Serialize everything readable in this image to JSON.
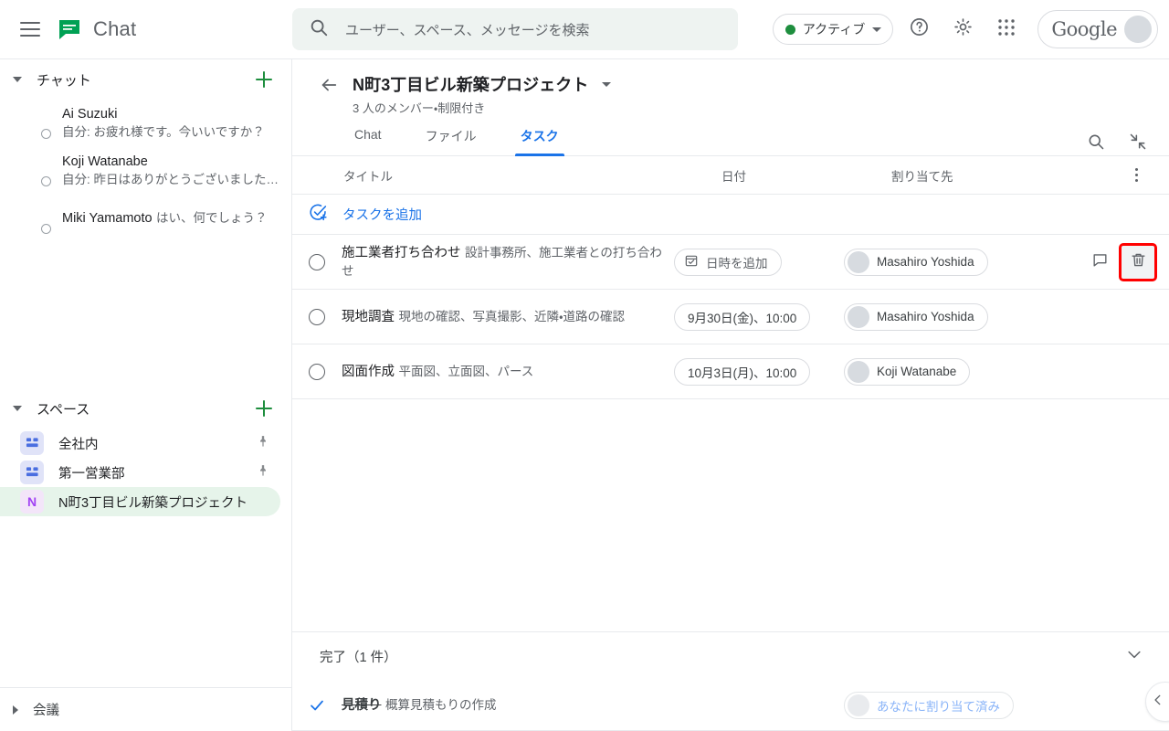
{
  "app": {
    "brand_name": "Chat",
    "logo_color": "#00a154"
  },
  "topbar": {
    "menu_icon": "hamburger-icon",
    "search_placeholder": "ユーザー、スペース、メッセージを検索",
    "search_icon": "search-icon",
    "status_label": "アクティブ",
    "status_color": "#1e8e3e",
    "help_icon": "help-icon",
    "settings_icon": "gear-icon",
    "apps_icon": "apps-grid-icon",
    "account_word": "Google",
    "avatar_icon": "account-avatar"
  },
  "sidebar": {
    "chat_section": {
      "title": "チャット",
      "add_icon": "plus-icon",
      "items": [
        {
          "name": "Ai Suzuki",
          "snippet": "自分: お疲れ様です。今いいですか？"
        },
        {
          "name": "Koji Watanabe",
          "snippet": "自分: 昨日はありがとうございました…"
        },
        {
          "name": "Miki Yamamoto",
          "snippet": "はい、何でしょう？"
        }
      ]
    },
    "spaces_section": {
      "title": "スペース",
      "add_icon": "plus-icon",
      "items": [
        {
          "label": "全社内",
          "icon": "space-grid-icon",
          "pinned": true,
          "active": false
        },
        {
          "label": "第一営業部",
          "icon": "space-grid-icon",
          "pinned": true,
          "active": false
        },
        {
          "label": "N町3丁目ビル新築プロジェクト",
          "icon": "N",
          "pinned": false,
          "active": true
        }
      ]
    },
    "meetings_section": {
      "title": "会議"
    }
  },
  "main": {
    "back_icon": "back-arrow-icon",
    "space_title": "N町3丁目ビル新築プロジェクト",
    "space_dropdown_icon": "chevron-down-icon",
    "space_subtitle": "3 人のメンバー・制限付き",
    "search_icon": "search-icon",
    "collapse_icon": "collapse-icon",
    "tabs": [
      {
        "label": "Chat",
        "active": false
      },
      {
        "label": "ファイル",
        "active": false
      },
      {
        "label": "タスク",
        "active": true
      }
    ],
    "active_tab_color": "#1a73e8"
  },
  "tasks": {
    "columns": {
      "title": "タイトル",
      "date": "日付",
      "assignee": "割り当て先",
      "menu_icon": "kebab-menu-icon"
    },
    "add_task": {
      "label": "タスクを追加",
      "icon": "add-task-icon",
      "color": "#1a73e8"
    },
    "rows": [
      {
        "title": "施工業者打ち合わせ",
        "description": "設計事務所、施工業者との打ち合わせ",
        "date_label": "日時を追加",
        "date_is_placeholder": true,
        "date_icon": "calendar-icon",
        "assignee": "Masahiro Yoshida",
        "avatar": "face-2",
        "comment_icon": "comment-icon",
        "delete_icon": "trash-icon",
        "delete_highlighted": true,
        "highlight_color": "#ff0000"
      },
      {
        "title": "現地調査",
        "description": "現地の確認、写真撮影、近隣・道路の確認",
        "date_label": "9月30日(金)、10:00",
        "date_is_placeholder": false,
        "assignee": "Masahiro Yoshida",
        "avatar": "face-2"
      },
      {
        "title": "図面作成",
        "description": "平面図、立面図、パース",
        "date_label": "10月3日(月)、10:00",
        "date_is_placeholder": false,
        "assignee": "Koji Watanabe",
        "avatar": "face-3"
      }
    ],
    "completed": {
      "header": "完了（1 件）",
      "toggle_icon": "chevron-down-icon",
      "rows": [
        {
          "title": "見積り",
          "description": "概算見積もりの作成",
          "assignee": "あなたに割り当て済み",
          "avatar": "face-4",
          "check_icon": "check-icon",
          "check_color": "#1a73e8"
        }
      ]
    }
  },
  "footer": {
    "collapse_handle_icon": "chevron-left-icon"
  }
}
